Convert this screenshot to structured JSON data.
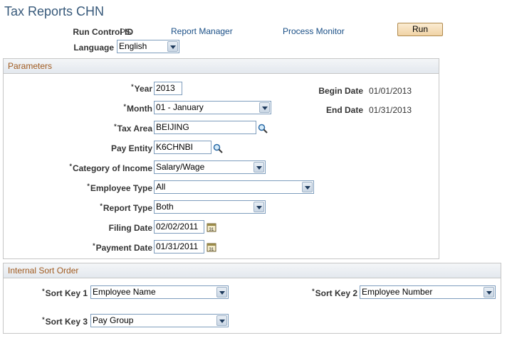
{
  "page": {
    "title": "Tax Reports CHN",
    "run_control_label": "Run Control ID",
    "run_control_value": "PS",
    "report_manager_link": "Report Manager",
    "process_monitor_link": "Process Monitor",
    "run_button": "Run",
    "language_label": "Language",
    "language_value": "English"
  },
  "parameters": {
    "header": "Parameters",
    "year_label": "Year",
    "year_value": "2013",
    "month_label": "Month",
    "month_value": "01 - January",
    "tax_area_label": "Tax Area",
    "tax_area_value": "BEIJING",
    "pay_entity_label": "Pay Entity",
    "pay_entity_value": "K6CHNBI",
    "category_label": "Category of Income",
    "category_value": "Salary/Wage",
    "employee_type_label": "Employee Type",
    "employee_type_value": "All",
    "report_type_label": "Report Type",
    "report_type_value": "Both",
    "filing_date_label": "Filing Date",
    "filing_date_value": "02/02/2011",
    "payment_date_label": "Payment Date",
    "payment_date_value": "01/31/2011",
    "begin_date_label": "Begin Date",
    "begin_date_value": "01/01/2013",
    "end_date_label": "End Date",
    "end_date_value": "01/31/2013",
    "required_marker": "*"
  },
  "sort_order": {
    "header": "Internal Sort Order",
    "sort_key1_label": "Sort Key 1",
    "sort_key1_value": "Employee Name",
    "sort_key2_label": "Sort Key 2",
    "sort_key2_value": "Employee Number",
    "sort_key3_label": "Sort Key 3",
    "sort_key3_value": "Pay Group"
  },
  "icons": {
    "lookup": "magnifier-icon",
    "calendar": "calendar-icon"
  },
  "colors": {
    "title": "#37597a",
    "link": "#1a4f86",
    "section_header_text": "#a05a1f",
    "field_border": "#7e9dbd",
    "button_fill": "#f0d3a5"
  }
}
